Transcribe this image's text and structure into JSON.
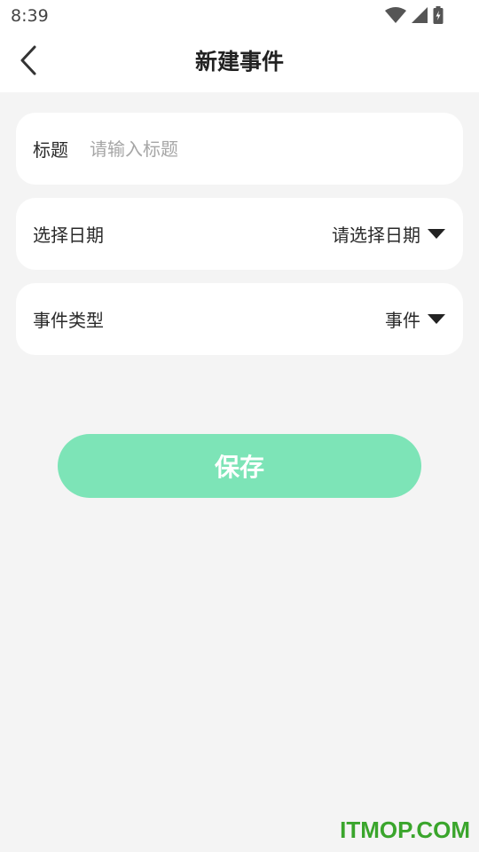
{
  "status_bar": {
    "time": "8:39",
    "icons": [
      "wifi-icon",
      "cell-signal-icon",
      "battery-charging-icon"
    ]
  },
  "header": {
    "back_icon": "chevron-left-icon",
    "title": "新建事件"
  },
  "form": {
    "title_field": {
      "label": "标题",
      "value": "",
      "placeholder": "请输入标题"
    },
    "date_field": {
      "label": "选择日期",
      "value": "请选择日期",
      "icon": "caret-down-icon"
    },
    "type_field": {
      "label": "事件类型",
      "value": "事件",
      "icon": "caret-down-icon"
    }
  },
  "actions": {
    "save_label": "保存"
  },
  "watermark": {
    "text": "ITMOP.COM"
  },
  "colors": {
    "background": "#f4f4f4",
    "card": "#ffffff",
    "accent": "#7de4b7",
    "watermark": "#3aa52c"
  }
}
